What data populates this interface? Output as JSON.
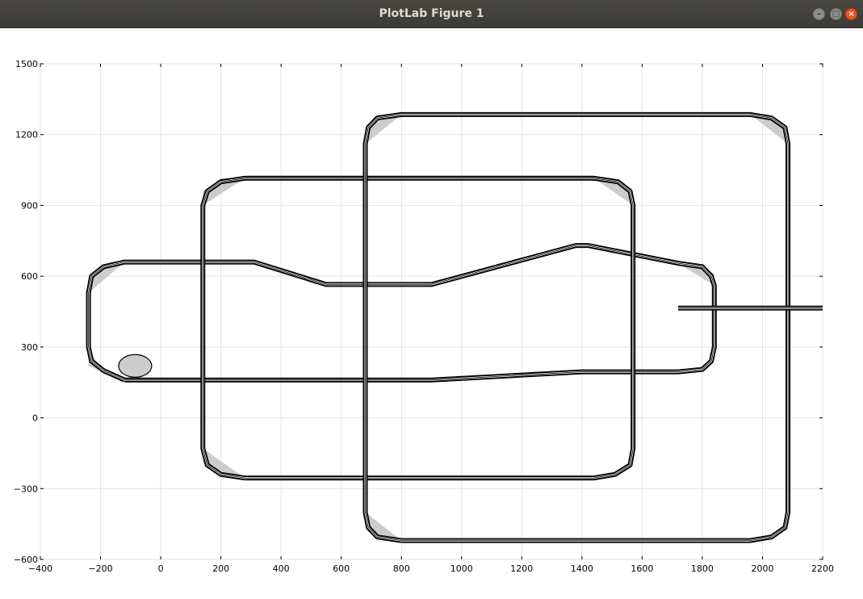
{
  "window": {
    "title": "PlotLab Figure 1",
    "minimize_icon": "minimize-icon",
    "maximize_icon": "maximize-icon",
    "close_icon": "close-icon"
  },
  "chart_data": {
    "type": "line",
    "title": "",
    "xlabel": "",
    "ylabel": "",
    "xlim": [
      -400,
      2200
    ],
    "ylim": [
      -600,
      1500
    ],
    "xticks": [
      -400,
      -200,
      0,
      200,
      400,
      600,
      800,
      1000,
      1200,
      1400,
      1600,
      1800,
      2000,
      2200
    ],
    "yticks": [
      -600,
      -300,
      0,
      300,
      600,
      900,
      1200,
      1500
    ],
    "xtick_labels": [
      "−400",
      "−200",
      "0",
      "200",
      "400",
      "600",
      "800",
      "1000",
      "1200",
      "1400",
      "1600",
      "1800",
      "2000",
      "2200"
    ],
    "ytick_labels": [
      "−600",
      "−300",
      "0",
      "300",
      "600",
      "900",
      "1200",
      "1500"
    ],
    "grid": true,
    "line_color": "#000000",
    "fill_color": "#cccccc",
    "series": [
      {
        "path": [
          [
            -120,
            160
          ],
          [
            550,
            160
          ],
          [
            900,
            160
          ],
          [
            1400,
            195
          ],
          [
            1720,
            195
          ],
          [
            1800,
            205
          ],
          [
            1830,
            240
          ],
          [
            1840,
            300
          ],
          [
            1840,
            560
          ],
          [
            1830,
            600
          ],
          [
            1800,
            640
          ],
          [
            1720,
            655
          ],
          [
            1420,
            730
          ],
          [
            1380,
            730
          ],
          [
            900,
            565
          ],
          [
            550,
            565
          ],
          [
            310,
            660
          ],
          [
            -120,
            660
          ],
          [
            -190,
            640
          ],
          [
            -230,
            600
          ],
          [
            -240,
            530
          ],
          [
            -240,
            300
          ],
          [
            -230,
            240
          ],
          [
            -190,
            200
          ],
          [
            -120,
            160
          ]
        ]
      },
      {
        "path": [
          [
            280,
            -255
          ],
          [
            1440,
            -255
          ],
          [
            1510,
            -240
          ],
          [
            1560,
            -200
          ],
          [
            1570,
            -130
          ],
          [
            1570,
            900
          ],
          [
            1560,
            960
          ],
          [
            1520,
            1000
          ],
          [
            1440,
            1015
          ],
          [
            280,
            1015
          ],
          [
            200,
            1000
          ],
          [
            155,
            960
          ],
          [
            140,
            900
          ],
          [
            140,
            -130
          ],
          [
            155,
            -200
          ],
          [
            200,
            -240
          ],
          [
            280,
            -255
          ]
        ]
      },
      {
        "path": [
          [
            800,
            -520
          ],
          [
            1960,
            -520
          ],
          [
            2030,
            -505
          ],
          [
            2075,
            -465
          ],
          [
            2085,
            -400
          ],
          [
            2085,
            1160
          ],
          [
            2075,
            1230
          ],
          [
            2030,
            1270
          ],
          [
            1960,
            1285
          ],
          [
            800,
            1285
          ],
          [
            720,
            1270
          ],
          [
            690,
            1230
          ],
          [
            680,
            1160
          ],
          [
            680,
            -400
          ],
          [
            690,
            -465
          ],
          [
            720,
            -505
          ],
          [
            800,
            -520
          ]
        ]
      },
      {
        "path": [
          [
            1720,
            465
          ],
          [
            2200,
            465
          ]
        ]
      }
    ],
    "corner_fills": [
      [
        [
          -120,
          660
        ],
        [
          -240,
          530
        ],
        [
          -240,
          580
        ],
        [
          -170,
          660
        ]
      ],
      [
        [
          -240,
          280
        ],
        [
          -180,
          190
        ],
        [
          -120,
          160
        ],
        [
          -240,
          220
        ]
      ],
      [
        [
          1720,
          655
        ],
        [
          1840,
          560
        ],
        [
          1840,
          610
        ],
        [
          1780,
          655
        ]
      ],
      [
        [
          280,
          1015
        ],
        [
          140,
          900
        ],
        [
          140,
          960
        ],
        [
          200,
          1015
        ]
      ],
      [
        [
          1440,
          1015
        ],
        [
          1570,
          900
        ],
        [
          1570,
          950
        ],
        [
          1500,
          1015
        ]
      ],
      [
        [
          140,
          -130
        ],
        [
          280,
          -255
        ],
        [
          220,
          -255
        ],
        [
          140,
          -190
        ]
      ],
      [
        [
          800,
          1285
        ],
        [
          680,
          1160
        ],
        [
          680,
          1220
        ],
        [
          740,
          1285
        ]
      ],
      [
        [
          1960,
          1285
        ],
        [
          2085,
          1160
        ],
        [
          2085,
          1220
        ],
        [
          2020,
          1285
        ]
      ],
      [
        [
          680,
          -400
        ],
        [
          800,
          -520
        ],
        [
          740,
          -520
        ],
        [
          680,
          -450
        ]
      ]
    ],
    "ellipse": {
      "cx": -85,
      "cy": 220,
      "rx": 55,
      "ry": 48
    }
  }
}
